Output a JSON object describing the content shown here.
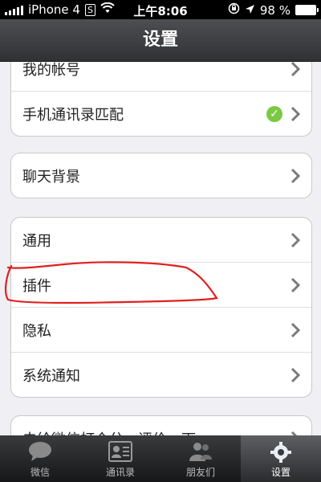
{
  "status_bar": {
    "carrier": "iPhone 4",
    "network": "S",
    "time": "上午8:06",
    "battery_percent": "98 %",
    "battery_level": 0.98
  },
  "nav": {
    "title": "设置"
  },
  "groups": [
    {
      "rows": [
        {
          "label": "我的帐号"
        },
        {
          "label": "手机通讯录匹配",
          "has_check": true
        }
      ]
    },
    {
      "rows": [
        {
          "label": "聊天背景"
        }
      ]
    },
    {
      "rows": [
        {
          "label": "通用"
        },
        {
          "label": "插件"
        },
        {
          "label": "隐私"
        },
        {
          "label": "系统通知"
        }
      ]
    },
    {
      "rows": [
        {
          "label": "去给微信打个分，评价一下"
        }
      ]
    }
  ],
  "tabs": [
    {
      "label": "微信",
      "icon": "chat-bubble-icon"
    },
    {
      "label": "通讯录",
      "icon": "contacts-icon"
    },
    {
      "label": "朋友们",
      "icon": "friends-icon"
    },
    {
      "label": "设置",
      "icon": "gear-icon",
      "active": true
    }
  ],
  "colors": {
    "check": "#7ac943",
    "annotation": "#e02020"
  }
}
